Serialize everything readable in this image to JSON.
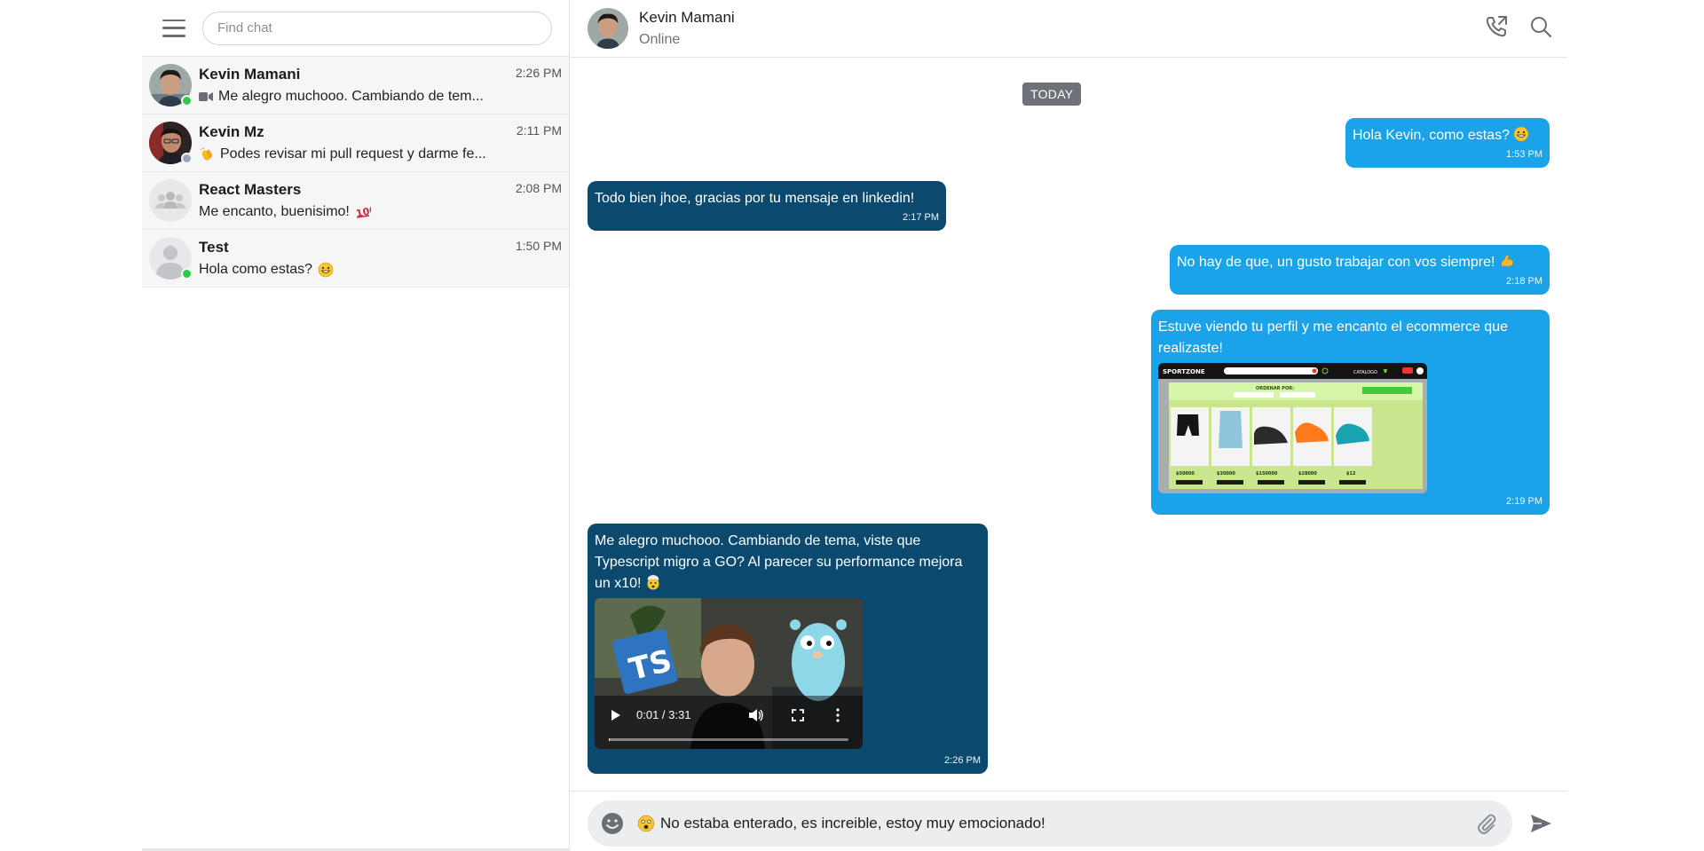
{
  "sidebar": {
    "search_placeholder": "Find chat",
    "chats": [
      {
        "name": "Kevin Mamani",
        "time": "2:26 PM",
        "preview": "Me alegro muchooo. Cambiando de tem...",
        "preview_icon": "video-camera-icon",
        "status": "online"
      },
      {
        "name": "Kevin Mz",
        "time": "2:11 PM",
        "preview": "Podes revisar mi pull request y darme fe...",
        "preview_icon": "clapping-hands-emoji",
        "status": "offline"
      },
      {
        "name": "React Masters",
        "time": "2:08 PM",
        "preview": "Me encanto, buenisimo!",
        "preview_icon": "hundred-points-emoji",
        "status": "none"
      },
      {
        "name": "Test",
        "time": "1:50 PM",
        "preview": "Hola como estas?",
        "preview_icon": "grinning-emoji",
        "status": "online"
      }
    ]
  },
  "header": {
    "name": "Kevin Mamani",
    "status": "Online"
  },
  "messages": {
    "date_label": "TODAY",
    "items": [
      {
        "direction": "out",
        "text": "Hola Kevin, como estas?",
        "emoji": "grinning-emoji",
        "time": "1:53 PM"
      },
      {
        "direction": "in",
        "text": "Todo bien jhoe, gracias por tu mensaje en linkedin!",
        "time": "2:17 PM"
      },
      {
        "direction": "out",
        "text": "No hay de que, un gusto trabajar con vos siempre!",
        "emoji": "flexed-biceps-emoji",
        "time": "2:18 PM"
      },
      {
        "direction": "out",
        "text": "Estuve viendo tu perfil y me encanto el ecommerce que realizaste!",
        "attachment": "image",
        "time": "2:19 PM"
      },
      {
        "direction": "in",
        "text": "Me alegro muchooo. Cambiando de tema, viste que Typescript migro a GO? Al parecer su performance mejora un x10!",
        "emoji": "exploding-head-emoji",
        "attachment": "video",
        "time": "2:26 PM"
      }
    ]
  },
  "attachment_image": {
    "brand": "SPORTZONE",
    "nav": "CATALOGO",
    "heading": "ORDENAR POR:",
    "prices": [
      "$50000",
      "$30000",
      "$150000",
      "$28000",
      "$12"
    ]
  },
  "video": {
    "time_display": "0:01 / 3:31",
    "progress": 0.005,
    "badge": "TS"
  },
  "composer": {
    "value": "No estaba enterado, es increible, estoy muy emocionado!",
    "emoji": "astonished-emoji"
  },
  "colors": {
    "outgoing": "#1aa3e8",
    "incoming": "#0b4a6e",
    "online": "#2fc84d",
    "offline": "#9aa6b6"
  }
}
